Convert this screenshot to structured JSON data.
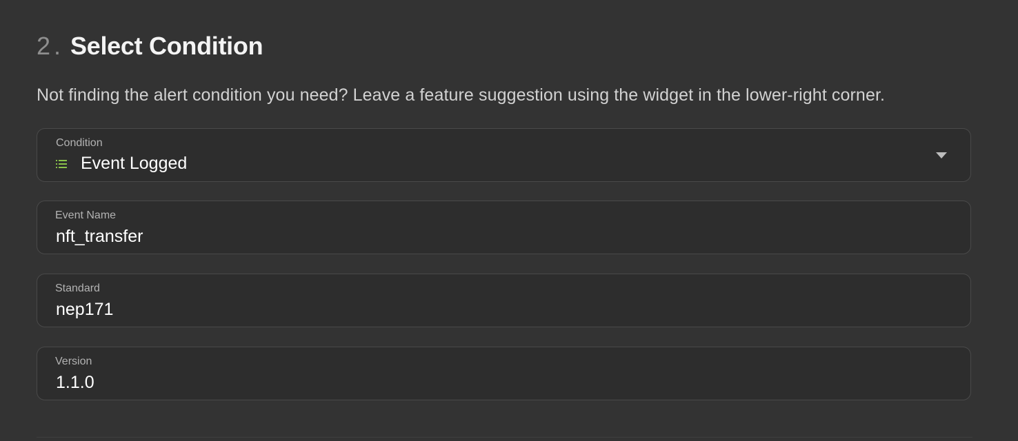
{
  "section": {
    "step_number": "2",
    "step_separator": ".",
    "title": "Select Condition",
    "hint": "Not finding the alert condition you need? Leave a feature suggestion using the widget in the lower-right corner."
  },
  "fields": {
    "condition": {
      "label": "Condition",
      "value": "Event Logged",
      "icon": "list-icon",
      "icon_color": "#8bc34a"
    },
    "event_name": {
      "label": "Event Name",
      "value": "nft_transfer"
    },
    "standard": {
      "label": "Standard",
      "value": "nep171"
    },
    "version": {
      "label": "Version",
      "value": "1.1.0"
    }
  },
  "colors": {
    "background": "#333333",
    "field_background": "#2d2d2d",
    "field_border": "#4a4a4a"
  }
}
